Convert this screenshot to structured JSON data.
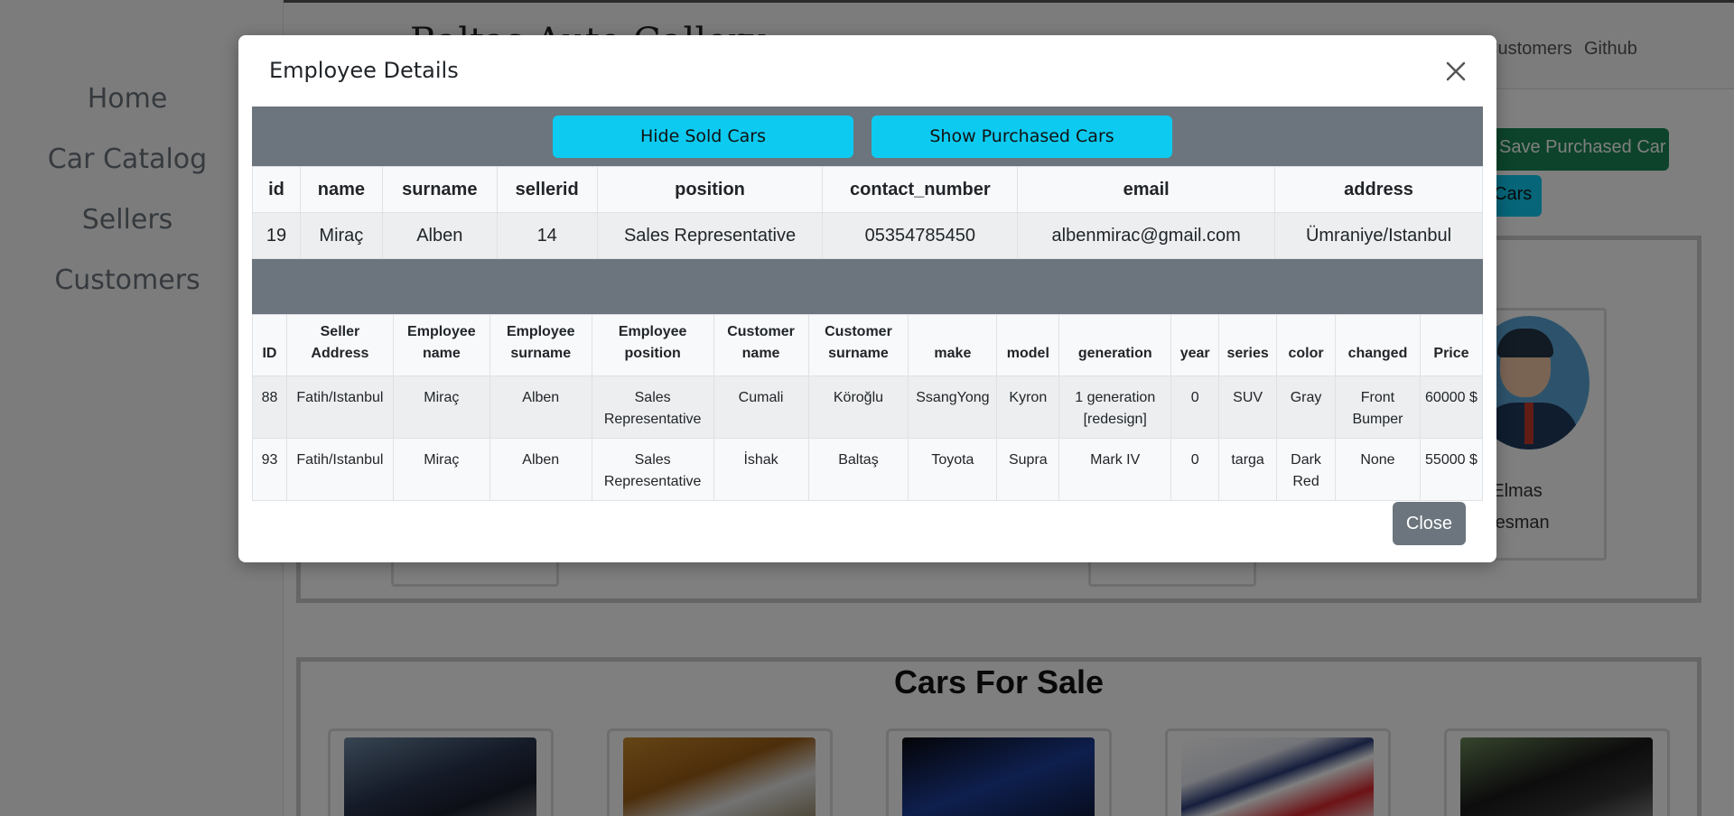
{
  "brand": "Baltas Auto Gallery",
  "sidebar": {
    "items": [
      {
        "label": "Home"
      },
      {
        "label": "Car Catalog"
      },
      {
        "label": "Sellers"
      },
      {
        "label": "Customers"
      }
    ]
  },
  "topnav": {
    "customers": "Customers",
    "github": "Github"
  },
  "background_buttons": {
    "save_purchased": "Save Purchased Car",
    "cars_partial": "Cars"
  },
  "employee_card": {
    "name_partial": "kut Elmas",
    "role_partial": "alesman"
  },
  "for_sale": {
    "title": "Cars For Sale"
  },
  "modal": {
    "title": "Employee Details",
    "hide_sold_label": "Hide Sold Cars",
    "show_purchased_label": "Show Purchased Cars",
    "close_label": "Close",
    "employee_table": {
      "headers": [
        "id",
        "name",
        "surname",
        "sellerid",
        "position",
        "contact_number",
        "email",
        "address"
      ],
      "row": [
        "19",
        "Miraç",
        "Alben",
        "14",
        "Sales Representative",
        "05354785450",
        "albenmirac@gmail.com",
        "Ümraniye/Istanbul"
      ]
    },
    "sold_table": {
      "headers": [
        "ID",
        "Seller Address",
        "Employee name",
        "Employee surname",
        "Employee position",
        "Customer name",
        "Customer surname",
        "make",
        "model",
        "generation",
        "year",
        "series",
        "color",
        "changed",
        "Price"
      ],
      "rows": [
        [
          "88",
          "Fatih/Istanbul",
          "Miraç",
          "Alben",
          "Sales Representative",
          "Cumali",
          "Köroğlu",
          "SsangYong",
          "Kyron",
          "1 generation [redesign]",
          "0",
          "SUV",
          "Gray",
          "Front Bumper",
          "60000 $"
        ],
        [
          "93",
          "Fatih/Istanbul",
          "Miraç",
          "Alben",
          "Sales Representative",
          "İshak",
          "Baltaş",
          "Toyota",
          "Supra",
          "Mark IV",
          "0",
          "targa",
          "Dark Red",
          "None",
          "55000 $"
        ]
      ]
    }
  },
  "colors": {
    "accent_cyan": "#0dcaf0",
    "success_green": "#198754",
    "secondary_gray": "#6c757d"
  }
}
